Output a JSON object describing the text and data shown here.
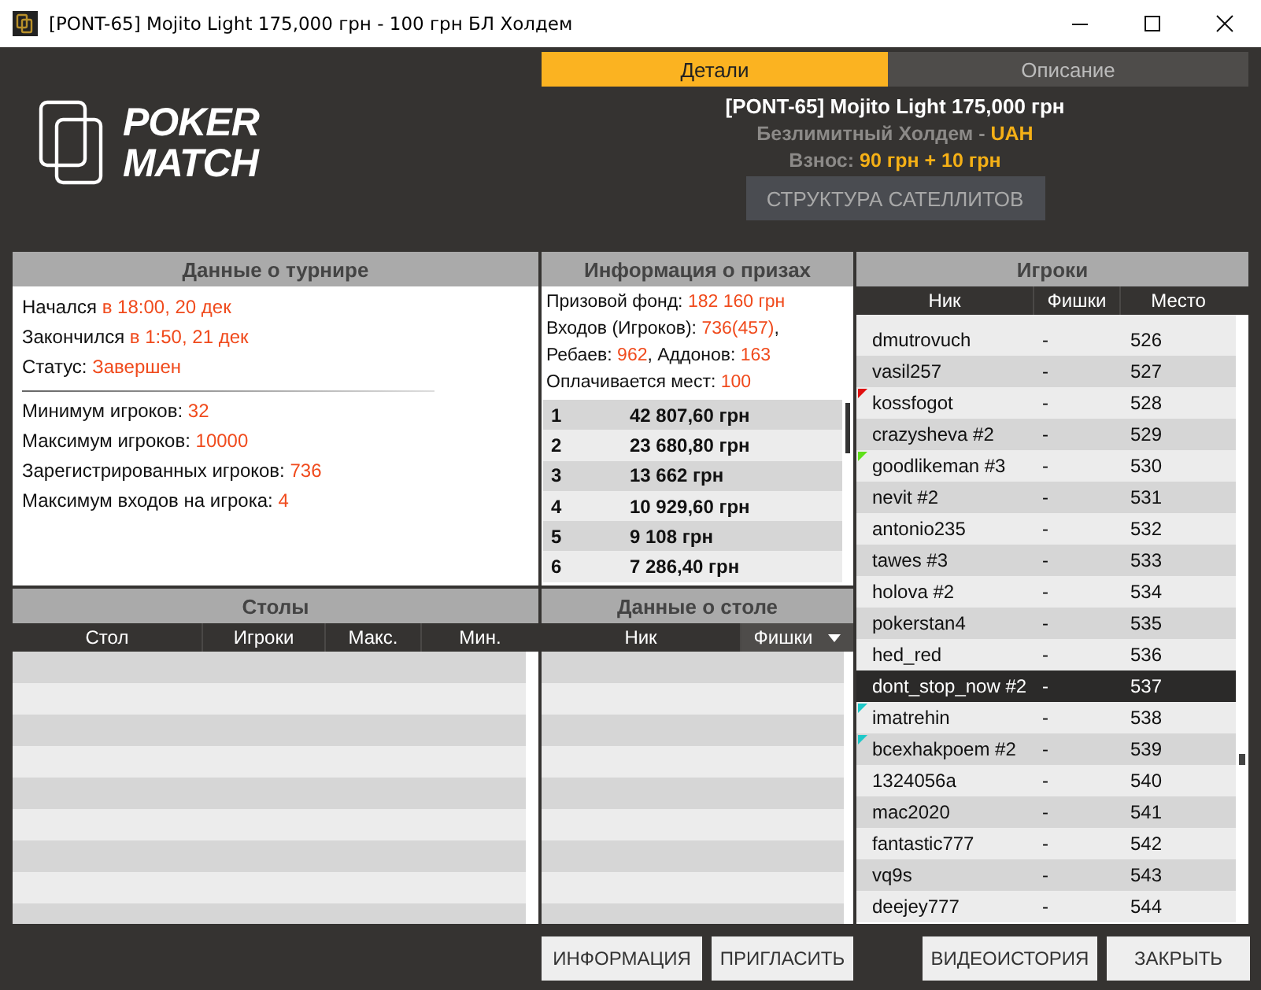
{
  "window": {
    "title": "[PONT-65] Mojito Light 175,000 грн - 100 грн БЛ Холдем"
  },
  "logo": {
    "line_1": "POKER",
    "line_2": "MATCH"
  },
  "tabs": [
    {
      "label": "Детали",
      "selected": true
    },
    {
      "label": "Описание",
      "selected": false
    }
  ],
  "tournament_header": {
    "title": "[PONT-65] Mojito Light 175,000 грн",
    "game": "Безлимитный Холдем - ",
    "currency": "UAH",
    "fee_label": "Взнос: ",
    "fee_value": "90 грн + 10 грн",
    "satellites_button": "СТРУКТУРА САТЕЛЛИТОВ"
  },
  "tournament_data": {
    "title": "Данные о турнире",
    "lines": [
      {
        "label": "Начался ",
        "value": "в 18:00, 20 дек"
      },
      {
        "label": "Закончился ",
        "value": "в 1:50, 21 дек"
      },
      {
        "label": "Статус: ",
        "value": "Завершен"
      }
    ],
    "limits": [
      {
        "label": "Минимум игроков: ",
        "value": "32"
      },
      {
        "label": "Максимум игроков: ",
        "value": "10000"
      },
      {
        "label": "Зарегистрированных игроков: ",
        "value": "736"
      },
      {
        "label": "Максимум входов на игрока: ",
        "value": "4"
      }
    ]
  },
  "prize_info": {
    "title": "Информация о призах",
    "lines": [
      [
        {
          "kind": "label",
          "text": "Призовой фонд: "
        },
        {
          "kind": "value",
          "text": "182 160 грн"
        }
      ],
      [
        {
          "kind": "label",
          "text": "Входов (Игроков): "
        },
        {
          "kind": "value",
          "text": "736(457)"
        },
        {
          "kind": "label",
          "text": ", Ребаев: "
        },
        {
          "kind": "value",
          "text": "962"
        },
        {
          "kind": "label",
          "text": ", Аддонов: "
        },
        {
          "kind": "value",
          "text": "163"
        }
      ],
      [
        {
          "kind": "label",
          "text": "Оплачивается мест: "
        },
        {
          "kind": "value",
          "text": "100"
        }
      ]
    ],
    "prizes": [
      {
        "place": "1",
        "amount": "42 807,60 грн"
      },
      {
        "place": "2",
        "amount": "23 680,80 грн"
      },
      {
        "place": "3",
        "amount": "13 662 грн"
      },
      {
        "place": "4",
        "amount": "10 929,60 грн"
      },
      {
        "place": "5",
        "amount": "9 108 грн"
      },
      {
        "place": "6",
        "amount": "7 286,40 грн"
      }
    ]
  },
  "players": {
    "title": "Игроки",
    "columns": [
      "Ник",
      "Фишки",
      "Место"
    ],
    "rows": [
      {
        "nick": "dmutrovuch",
        "chips": "-",
        "place": "526",
        "selected": false
      },
      {
        "nick": "vasil257",
        "chips": "-",
        "place": "527",
        "selected": false
      },
      {
        "nick": "kossfogot",
        "chips": "-",
        "place": "528",
        "selected": false,
        "color": "#e01010"
      },
      {
        "nick": "crazysheva #2",
        "chips": "-",
        "place": "529",
        "selected": false
      },
      {
        "nick": "goodlikeman #3",
        "chips": "-",
        "place": "530",
        "selected": false,
        "color": "#5fe01a"
      },
      {
        "nick": "nevit #2",
        "chips": "-",
        "place": "531",
        "selected": false
      },
      {
        "nick": "antonio235",
        "chips": "-",
        "place": "532",
        "selected": false
      },
      {
        "nick": "tawes #3",
        "chips": "-",
        "place": "533",
        "selected": false
      },
      {
        "nick": "holova #2",
        "chips": "-",
        "place": "534",
        "selected": false
      },
      {
        "nick": "pokerstan4",
        "chips": "-",
        "place": "535",
        "selected": false
      },
      {
        "nick": "hed_red",
        "chips": "-",
        "place": "536",
        "selected": false
      },
      {
        "nick": "dont_stop_now #2",
        "chips": "-",
        "place": "537",
        "selected": true
      },
      {
        "nick": "imatrehin",
        "chips": "-",
        "place": "538",
        "selected": false,
        "color": "#1ec8c8"
      },
      {
        "nick": "bcexhakpoem #2",
        "chips": "-",
        "place": "539",
        "selected": false,
        "color": "#1ec8c8"
      },
      {
        "nick": "1324056a",
        "chips": "-",
        "place": "540",
        "selected": false
      },
      {
        "nick": "mac2020",
        "chips": "-",
        "place": "541",
        "selected": false
      },
      {
        "nick": "fantastic777",
        "chips": "-",
        "place": "542",
        "selected": false
      },
      {
        "nick": "vq9s",
        "chips": "-",
        "place": "543",
        "selected": false
      },
      {
        "nick": "deejey777",
        "chips": "-",
        "place": "544",
        "selected": false
      }
    ]
  },
  "tables": {
    "title": "Столы",
    "columns": [
      "Стол",
      "Игроки",
      "Макс.",
      "Мин."
    ]
  },
  "table_data": {
    "title": "Данные о столе",
    "columns": [
      "Ник",
      "Фишки"
    ]
  },
  "buttons": [
    "ИНФОРМАЦИЯ",
    "ПРИГЛАСИТЬ",
    "ВИДЕОИСТОРИЯ",
    "ЗАКРЫТЬ"
  ]
}
